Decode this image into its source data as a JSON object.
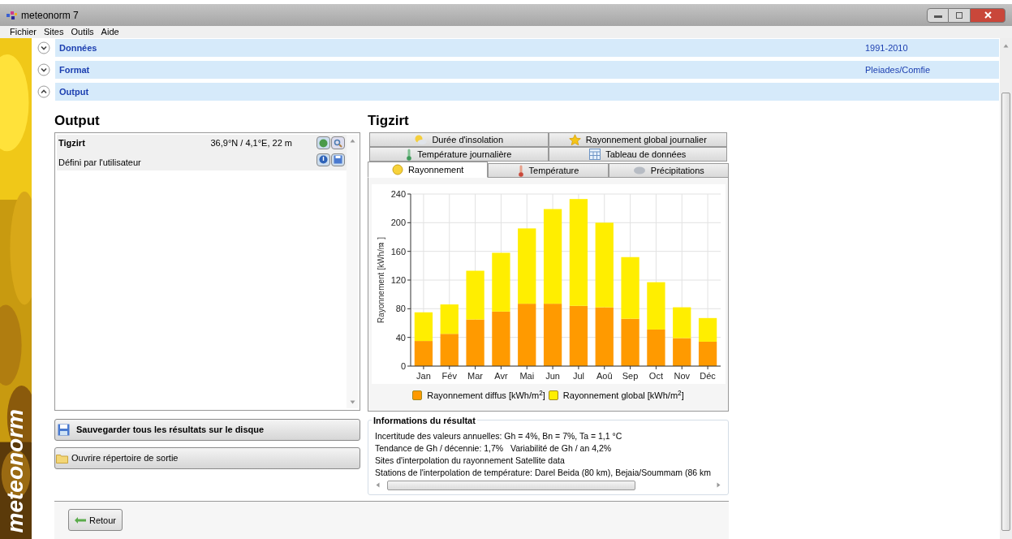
{
  "window": {
    "title": "meteonorm 7"
  },
  "menu": [
    "Fichier",
    "Sites",
    "Outils",
    "Aide"
  ],
  "sidebar": {
    "logo": "meteonorm"
  },
  "sections": [
    {
      "label": "Données",
      "value": "1991-2010",
      "expanded": false
    },
    {
      "label": "Format",
      "value": "Pleiades/Comfie",
      "expanded": false
    },
    {
      "label": "Output",
      "expanded": true
    }
  ],
  "output": {
    "heading": "Output",
    "site": {
      "name": "Tigzirt",
      "coords": "36,9°N / 4,1°E, 22 m",
      "source": "Défini par l'utilisateur"
    },
    "buttons": [
      {
        "label": "Sauvegarder tous les résultats sur le disque",
        "kind": "save"
      },
      {
        "label": "Ouvrire répertoire de sortie",
        "kind": "folder"
      }
    ]
  },
  "result": {
    "heading": "Tigzirt",
    "tab_rows": [
      [
        {
          "label": "Durée d'insolation",
          "kind": "sun-cloud",
          "selected": false
        },
        {
          "label": "Rayonnement global journalier",
          "kind": "star",
          "selected": false
        }
      ],
      [
        {
          "label": "Température journalière",
          "kind": "thermo-green",
          "selected": false
        },
        {
          "label": "Tableau de données",
          "kind": "table",
          "selected": false
        }
      ],
      [
        {
          "label": "Rayonnement",
          "kind": "sun",
          "selected": true
        },
        {
          "label": "Température",
          "kind": "thermo-red",
          "selected": false
        },
        {
          "label": "Précipitations",
          "kind": "cloud",
          "selected": false
        }
      ]
    ],
    "chart_data": {
      "type": "bar",
      "ylabel": "Rayonnement [kWh/m$^{2}$]",
      "categories": [
        "Jan",
        "Fév",
        "Mar",
        "Avr",
        "Mai",
        "Jun",
        "Jul",
        "Aoû",
        "Sep",
        "Oct",
        "Nov",
        "Déc"
      ],
      "series": [
        {
          "name": "Rayonnement diffus [kWh/m$^{2}$]",
          "color": "#ff9a00",
          "values": [
            35,
            45,
            65,
            76,
            87,
            87,
            84,
            82,
            66,
            51,
            39,
            34
          ]
        },
        {
          "name": "Rayonnement global  [kWh/m$^{2}$]",
          "color": "#ffee00",
          "values": [
            40,
            41,
            68,
            82,
            105,
            132,
            149,
            118,
            86,
            66,
            43,
            33
          ]
        }
      ],
      "ylim": [
        0,
        240
      ],
      "yticks": [
        0,
        40,
        80,
        120,
        160,
        200,
        240
      ],
      "stacked": true,
      "grid": true
    },
    "info": {
      "title": "Informations du résultat",
      "lines": [
        "Incertitude des valeurs annuelles: Gh = 4%, Bn = 7%, Ta = 1,1 °C",
        "Tendance de Gh / décennie: 1,7%   Variabilité de Gh / an 4,2%",
        "Sites d'interpolation du rayonnement Satellite data",
        "Stations de l'interpolation de température: Darel Beida (80 km), Bejaia/Soummam (86 km"
      ]
    }
  },
  "footer": {
    "back": "Retour"
  }
}
